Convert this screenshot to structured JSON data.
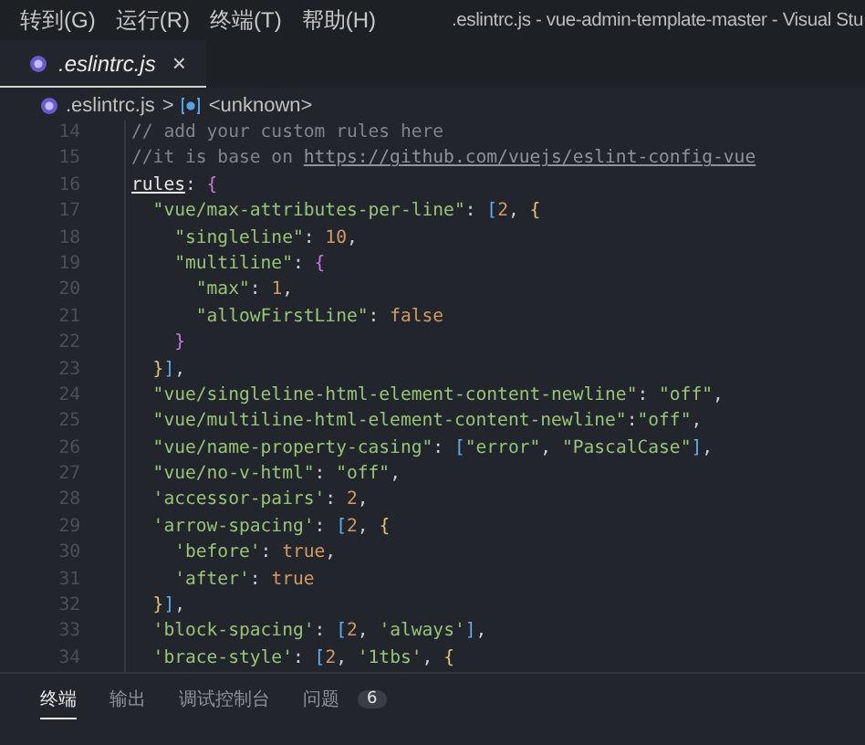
{
  "menu_bar": {
    "items": [
      "转到(G)",
      "运行(R)",
      "终端(T)",
      "帮助(H)"
    ],
    "window_title": ".eslintrc.js - vue-admin-template-master - Visual Stu"
  },
  "tabs": [
    {
      "label": ".eslintrc.js",
      "selected": true,
      "close": "×"
    }
  ],
  "breadcrumb": {
    "file": ".eslintrc.js",
    "separator": ">",
    "symbol": "<unknown>"
  },
  "editor": {
    "lines": [
      {
        "number": "14",
        "tokens": [
          {
            "kind": "comment",
            "text": "// add your custom rules here"
          }
        ]
      },
      {
        "number": "15",
        "tokens": [
          {
            "kind": "comment",
            "text": "//it is base on "
          },
          {
            "kind": "link",
            "text": "https://github.com/vuejs/eslint-config-vue"
          }
        ]
      },
      {
        "number": "16",
        "tokens": [
          {
            "kind": "key",
            "text": "rules"
          },
          {
            "kind": "punct",
            "text": ": "
          },
          {
            "kind": "brace2",
            "text": "{"
          }
        ]
      },
      {
        "number": "17",
        "tokens": [
          {
            "kind": "string",
            "text": "  \"vue/max-attributes-per-line\""
          },
          {
            "kind": "punct",
            "text": ": "
          },
          {
            "kind": "brace3",
            "text": "["
          },
          {
            "kind": "number",
            "text": "2"
          },
          {
            "kind": "punct",
            "text": ", "
          },
          {
            "kind": "brace1",
            "text": "{"
          }
        ]
      },
      {
        "number": "18",
        "tokens": [
          {
            "kind": "string",
            "text": "    \"singleline\""
          },
          {
            "kind": "punct",
            "text": ": "
          },
          {
            "kind": "number",
            "text": "10"
          },
          {
            "kind": "punct",
            "text": ","
          }
        ]
      },
      {
        "number": "19",
        "tokens": [
          {
            "kind": "string",
            "text": "    \"multiline\""
          },
          {
            "kind": "punct",
            "text": ": "
          },
          {
            "kind": "brace2",
            "text": "{"
          }
        ]
      },
      {
        "number": "20",
        "tokens": [
          {
            "kind": "string",
            "text": "      \"max\""
          },
          {
            "kind": "punct",
            "text": ": "
          },
          {
            "kind": "number",
            "text": "1"
          },
          {
            "kind": "punct",
            "text": ","
          }
        ]
      },
      {
        "number": "21",
        "tokens": [
          {
            "kind": "string",
            "text": "      \"allowFirstLine\""
          },
          {
            "kind": "punct",
            "text": ": "
          },
          {
            "kind": "number",
            "text": "false"
          }
        ]
      },
      {
        "number": "22",
        "tokens": [
          {
            "kind": "brace2",
            "text": "    }"
          }
        ]
      },
      {
        "number": "23",
        "tokens": [
          {
            "kind": "brace1",
            "text": "  }"
          },
          {
            "kind": "brace3",
            "text": "]"
          },
          {
            "kind": "punct",
            "text": ","
          }
        ]
      },
      {
        "number": "24",
        "tokens": [
          {
            "kind": "string",
            "text": "  \"vue/singleline-html-element-content-newline\""
          },
          {
            "kind": "punct",
            "text": ": "
          },
          {
            "kind": "string",
            "text": "\"off\""
          },
          {
            "kind": "punct",
            "text": ","
          }
        ]
      },
      {
        "number": "25",
        "tokens": [
          {
            "kind": "string",
            "text": "  \"vue/multiline-html-element-content-newline\""
          },
          {
            "kind": "punct",
            "text": ":"
          },
          {
            "kind": "string",
            "text": "\"off\""
          },
          {
            "kind": "punct",
            "text": ","
          }
        ]
      },
      {
        "number": "26",
        "tokens": [
          {
            "kind": "string",
            "text": "  \"vue/name-property-casing\""
          },
          {
            "kind": "punct",
            "text": ": "
          },
          {
            "kind": "brace3",
            "text": "["
          },
          {
            "kind": "string",
            "text": "\"error\""
          },
          {
            "kind": "punct",
            "text": ", "
          },
          {
            "kind": "string",
            "text": "\"PascalCase\""
          },
          {
            "kind": "brace3",
            "text": "]"
          },
          {
            "kind": "punct",
            "text": ","
          }
        ]
      },
      {
        "number": "27",
        "tokens": [
          {
            "kind": "string",
            "text": "  \"vue/no-v-html\""
          },
          {
            "kind": "punct",
            "text": ": "
          },
          {
            "kind": "string",
            "text": "\"off\""
          },
          {
            "kind": "punct",
            "text": ","
          }
        ]
      },
      {
        "number": "28",
        "tokens": [
          {
            "kind": "string",
            "text": "  'accessor-pairs'"
          },
          {
            "kind": "punct",
            "text": ": "
          },
          {
            "kind": "number",
            "text": "2"
          },
          {
            "kind": "punct",
            "text": ","
          }
        ]
      },
      {
        "number": "29",
        "tokens": [
          {
            "kind": "string",
            "text": "  'arrow-spacing'"
          },
          {
            "kind": "punct",
            "text": ": "
          },
          {
            "kind": "brace3",
            "text": "["
          },
          {
            "kind": "number",
            "text": "2"
          },
          {
            "kind": "punct",
            "text": ", "
          },
          {
            "kind": "brace1",
            "text": "{"
          }
        ]
      },
      {
        "number": "30",
        "tokens": [
          {
            "kind": "string",
            "text": "    'before'"
          },
          {
            "kind": "punct",
            "text": ": "
          },
          {
            "kind": "number",
            "text": "true"
          },
          {
            "kind": "punct",
            "text": ","
          }
        ]
      },
      {
        "number": "31",
        "tokens": [
          {
            "kind": "string",
            "text": "    'after'"
          },
          {
            "kind": "punct",
            "text": ": "
          },
          {
            "kind": "number",
            "text": "true"
          }
        ]
      },
      {
        "number": "32",
        "tokens": [
          {
            "kind": "brace1",
            "text": "  }"
          },
          {
            "kind": "brace3",
            "text": "]"
          },
          {
            "kind": "punct",
            "text": ","
          }
        ]
      },
      {
        "number": "33",
        "tokens": [
          {
            "kind": "string",
            "text": "  'block-spacing'"
          },
          {
            "kind": "punct",
            "text": ": "
          },
          {
            "kind": "brace3",
            "text": "["
          },
          {
            "kind": "number",
            "text": "2"
          },
          {
            "kind": "punct",
            "text": ", "
          },
          {
            "kind": "string",
            "text": "'always'"
          },
          {
            "kind": "brace3",
            "text": "]"
          },
          {
            "kind": "punct",
            "text": ","
          }
        ]
      },
      {
        "number": "34",
        "tokens": [
          {
            "kind": "string",
            "text": "  'brace-style'"
          },
          {
            "kind": "punct",
            "text": ": "
          },
          {
            "kind": "brace3",
            "text": "["
          },
          {
            "kind": "number",
            "text": "2"
          },
          {
            "kind": "punct",
            "text": ", "
          },
          {
            "kind": "string",
            "text": "'1tbs'"
          },
          {
            "kind": "punct",
            "text": ", "
          },
          {
            "kind": "brace1",
            "text": "{"
          }
        ]
      }
    ]
  },
  "panel": {
    "tabs": [
      {
        "label": "终端",
        "selected": true
      },
      {
        "label": "输出",
        "selected": false
      },
      {
        "label": "调试控制台",
        "selected": false
      },
      {
        "label": "问题",
        "selected": false,
        "badge": "6"
      }
    ]
  }
}
